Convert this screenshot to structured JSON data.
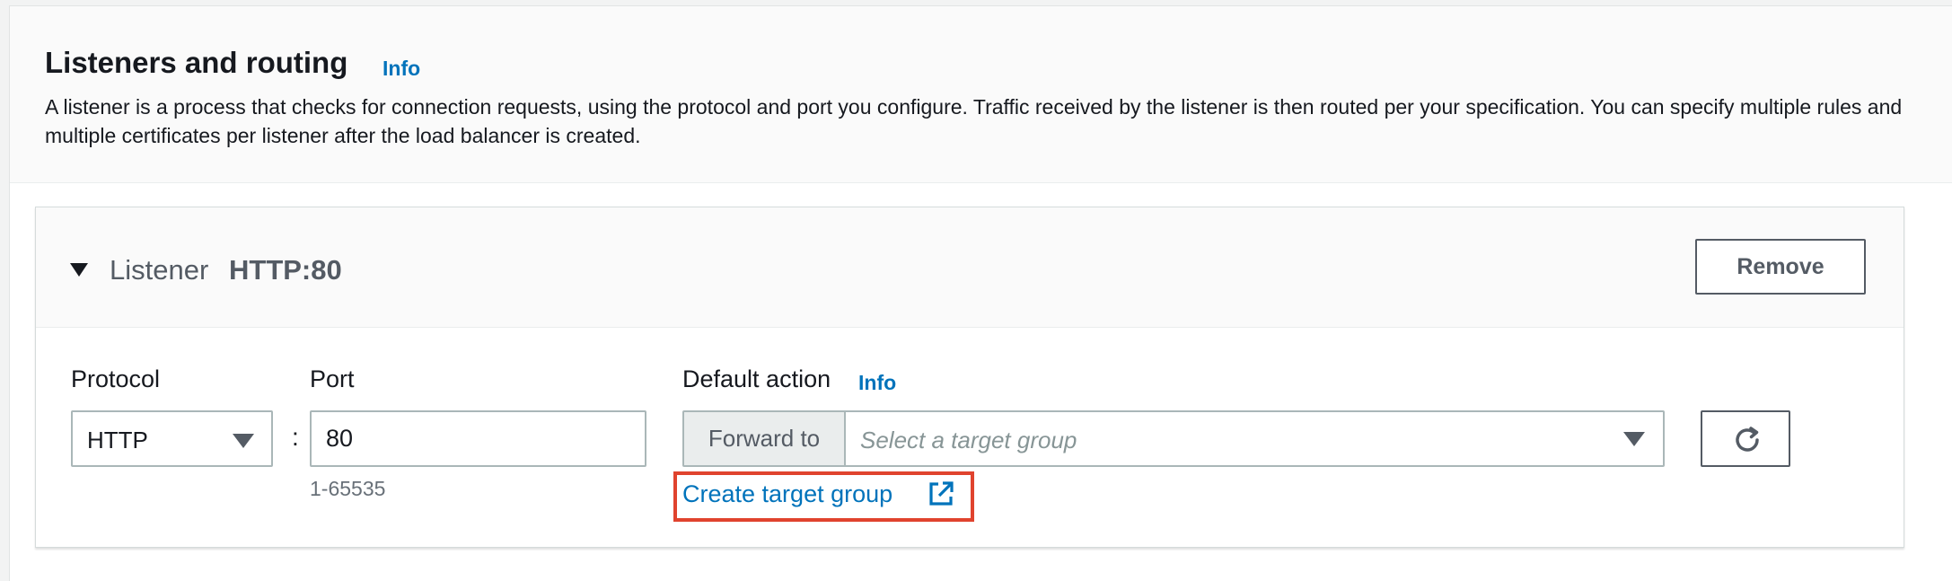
{
  "section": {
    "title": "Listeners and routing",
    "info_label": "Info",
    "description": "A listener is a process that checks for connection requests, using the protocol and port you configure. Traffic received by the listener is then routed per your specification. You can specify multiple rules and multiple certificates per listener after the load balancer is created."
  },
  "listener": {
    "label": "Listener",
    "name": "HTTP:80",
    "remove_label": "Remove",
    "protocol": {
      "label": "Protocol",
      "value": "HTTP"
    },
    "separator": ":",
    "port": {
      "label": "Port",
      "value": "80",
      "hint": "1-65535"
    },
    "default_action": {
      "label": "Default action",
      "info_label": "Info",
      "prefix": "Forward to",
      "placeholder": "Select a target group",
      "create_link": "Create target group"
    }
  },
  "icons": {
    "collapse": "caret-down-icon",
    "dropdown": "triangle-down-icon",
    "refresh": "refresh-icon",
    "external": "external-link-icon"
  },
  "colors": {
    "link": "#0073bb",
    "highlight": "#e0432e",
    "text": "#16191f",
    "muted": "#545b64"
  }
}
